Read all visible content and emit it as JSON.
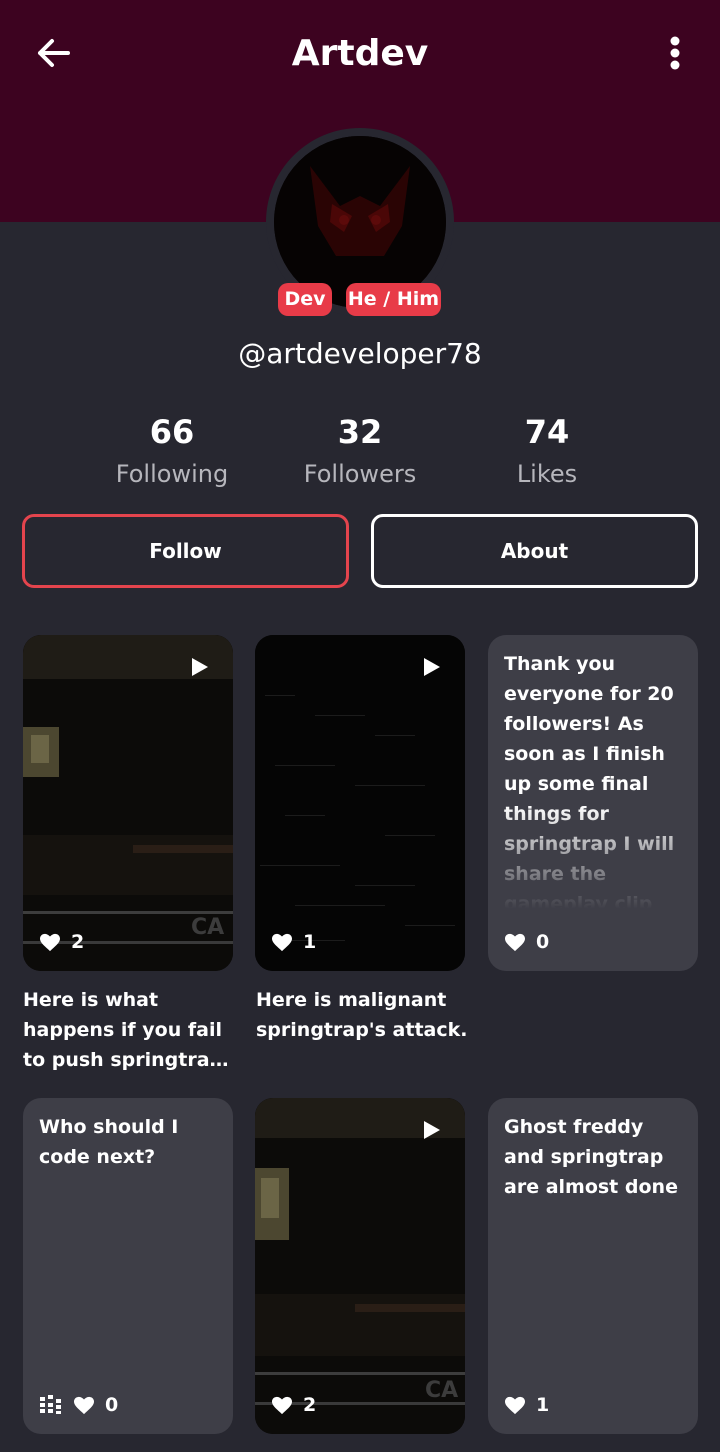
{
  "header": {
    "title": "Artdev"
  },
  "profile": {
    "badges": [
      "Dev",
      "He / Him"
    ],
    "username": "@artdeveloper78",
    "stats": [
      {
        "value": "66",
        "label": "Following"
      },
      {
        "value": "32",
        "label": "Followers"
      },
      {
        "value": "74",
        "label": "Likes"
      }
    ]
  },
  "actions": {
    "follow": "Follow",
    "about": "About"
  },
  "posts": [
    {
      "type": "video",
      "likes": "2",
      "caption": "Here is what happens if you fail to push springtrap away..."
    },
    {
      "type": "video",
      "likes": "1",
      "caption": "Here is malignant springtrap's attack."
    },
    {
      "type": "text",
      "likes": "0",
      "text": "Thank you everyone for 20 followers! As soon as I finish up some final things for springtrap I will share the gameplay clip"
    },
    {
      "type": "text",
      "likes": "0",
      "text": "Who should I code next?"
    },
    {
      "type": "video",
      "likes": "2"
    },
    {
      "type": "text",
      "likes": "1",
      "text": "Ghost freddy and springtrap are almost done"
    }
  ],
  "video_overlay_text": "CA",
  "colors": {
    "header": "#3d0320",
    "background": "#272730",
    "badge": "#e83b48",
    "follow_border": "#e4444d",
    "text_card": "#3e3e47"
  }
}
